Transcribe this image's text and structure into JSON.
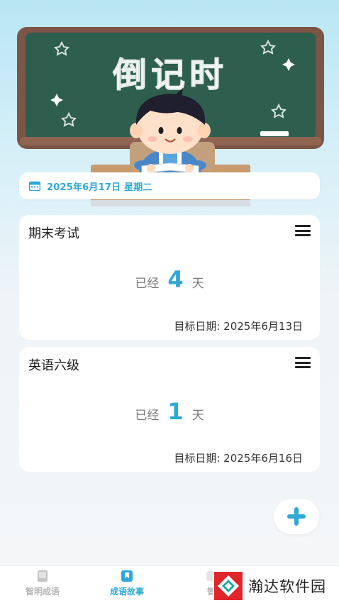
{
  "hero": {
    "board_text": "倒记时"
  },
  "date_bar": {
    "icon": "calendar-icon",
    "text": "2025年6月17日 星期二"
  },
  "cards": [
    {
      "title": "期末考试",
      "prefix": "已经",
      "days": "4",
      "suffix": "天",
      "target": "目标日期: 2025年6月13日"
    },
    {
      "title": "英语六级",
      "prefix": "已经",
      "days": "1",
      "suffix": "天",
      "target": "目标日期: 2025年6月16日"
    }
  ],
  "fab": {
    "icon": "plus-icon"
  },
  "tabbar": {
    "tabs": [
      {
        "label": "智明成语",
        "icon": "book-icon",
        "active": false
      },
      {
        "label": "成语故事",
        "icon": "bookmark-icon",
        "active": true
      },
      {
        "label": "智",
        "icon": "partial-icon",
        "active": false
      }
    ]
  },
  "watermark": {
    "text": "瀚达软件园"
  },
  "colors": {
    "accent": "#2ea8d8",
    "board": "#2d5e4e",
    "board_frame": "#7b5545",
    "inactive": "#b5b5b5"
  }
}
